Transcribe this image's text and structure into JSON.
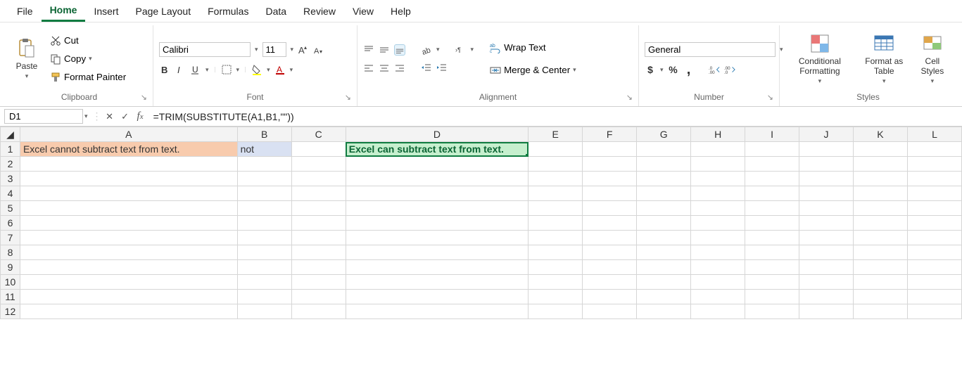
{
  "tabs": {
    "file": "File",
    "home": "Home",
    "insert": "Insert",
    "page_layout": "Page Layout",
    "formulas": "Formulas",
    "data": "Data",
    "review": "Review",
    "view": "View",
    "help": "Help"
  },
  "clipboard": {
    "paste": "Paste",
    "cut": "Cut",
    "copy": "Copy",
    "fp": "Format Painter",
    "label": "Clipboard"
  },
  "font": {
    "name": "Calibri",
    "size": "11",
    "label": "Font"
  },
  "alignment": {
    "wrap": "Wrap Text",
    "merge": "Merge & Center",
    "label": "Alignment"
  },
  "number": {
    "format": "General",
    "label": "Number"
  },
  "styles": {
    "cf": "Conditional Formatting",
    "fat": "Format as Table",
    "cs": "Cell Styles",
    "label": "Styles"
  },
  "fbar": {
    "namebox": "D1",
    "formula": "=TRIM(SUBSTITUTE(A1,B1,\"\"))"
  },
  "columns": [
    "A",
    "B",
    "C",
    "D",
    "E",
    "F",
    "G",
    "H",
    "I",
    "J",
    "K",
    "L"
  ],
  "rows": [
    "1",
    "2",
    "3",
    "4",
    "5",
    "6",
    "7",
    "8",
    "9",
    "10",
    "11",
    "12"
  ],
  "cells": {
    "A1": "Excel cannot subtract text from text.",
    "B1": "not",
    "D1": "Excel can subtract text from text."
  },
  "icons": {
    "caret": "▾",
    "percent": "%",
    "comma": ",",
    "dlg": "↘"
  }
}
